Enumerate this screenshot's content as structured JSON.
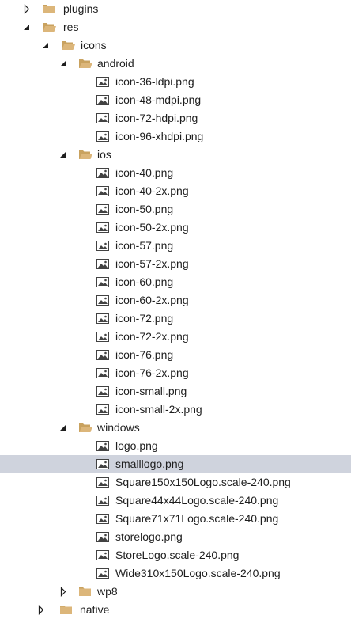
{
  "tree": {
    "items": [
      {
        "kind": "folder",
        "label": "plugins",
        "level": 0,
        "state": "collapsed"
      },
      {
        "kind": "folder",
        "label": "res",
        "level": 0,
        "state": "expanded"
      },
      {
        "kind": "folder",
        "label": "icons",
        "level": 1,
        "state": "expanded"
      },
      {
        "kind": "folder",
        "label": "android",
        "level": 2,
        "state": "expanded"
      },
      {
        "kind": "file",
        "label": "icon-36-ldpi.png",
        "level": 3
      },
      {
        "kind": "file",
        "label": "icon-48-mdpi.png",
        "level": 3
      },
      {
        "kind": "file",
        "label": "icon-72-hdpi.png",
        "level": 3
      },
      {
        "kind": "file",
        "label": "icon-96-xhdpi.png",
        "level": 3
      },
      {
        "kind": "folder",
        "label": "ios",
        "level": 2,
        "state": "expanded"
      },
      {
        "kind": "file",
        "label": "icon-40.png",
        "level": 3
      },
      {
        "kind": "file",
        "label": "icon-40-2x.png",
        "level": 3
      },
      {
        "kind": "file",
        "label": "icon-50.png",
        "level": 3
      },
      {
        "kind": "file",
        "label": "icon-50-2x.png",
        "level": 3
      },
      {
        "kind": "file",
        "label": "icon-57.png",
        "level": 3
      },
      {
        "kind": "file",
        "label": "icon-57-2x.png",
        "level": 3
      },
      {
        "kind": "file",
        "label": "icon-60.png",
        "level": 3
      },
      {
        "kind": "file",
        "label": "icon-60-2x.png",
        "level": 3
      },
      {
        "kind": "file",
        "label": "icon-72.png",
        "level": 3
      },
      {
        "kind": "file",
        "label": "icon-72-2x.png",
        "level": 3
      },
      {
        "kind": "file",
        "label": "icon-76.png",
        "level": 3
      },
      {
        "kind": "file",
        "label": "icon-76-2x.png",
        "level": 3
      },
      {
        "kind": "file",
        "label": "icon-small.png",
        "level": 3
      },
      {
        "kind": "file",
        "label": "icon-small-2x.png",
        "level": 3
      },
      {
        "kind": "folder",
        "label": "windows",
        "level": 2,
        "state": "expanded"
      },
      {
        "kind": "file",
        "label": "logo.png",
        "level": 3
      },
      {
        "kind": "file",
        "label": "smalllogo.png",
        "level": 3,
        "selected": true
      },
      {
        "kind": "file",
        "label": "Square150x150Logo.scale-240.png",
        "level": 3
      },
      {
        "kind": "file",
        "label": "Square44x44Logo.scale-240.png",
        "level": 3
      },
      {
        "kind": "file",
        "label": "Square71x71Logo.scale-240.png",
        "level": 3
      },
      {
        "kind": "file",
        "label": "storelogo.png",
        "level": 3
      },
      {
        "kind": "file",
        "label": "StoreLogo.scale-240.png",
        "level": 3
      },
      {
        "kind": "file",
        "label": "Wide310x150Logo.scale-240.png",
        "level": 3
      },
      {
        "kind": "folder",
        "label": "wp8",
        "level": 2,
        "state": "collapsed"
      },
      {
        "kind": "folder",
        "label": "native",
        "level": 1,
        "state": "collapsed"
      }
    ]
  },
  "colors": {
    "folder": "#dcb67a",
    "folder_dark": "#c9a25f",
    "selection": "#cfd3dd",
    "image_icon": "#424242",
    "expander": "#1e1e1e",
    "text": "#1e1e1e"
  },
  "icons": {
    "folder": "folder-icon",
    "folder_open": "folder-open-icon",
    "file": "image-file-icon",
    "expand": "chevron-right-icon",
    "collapse": "chevron-down-icon"
  }
}
